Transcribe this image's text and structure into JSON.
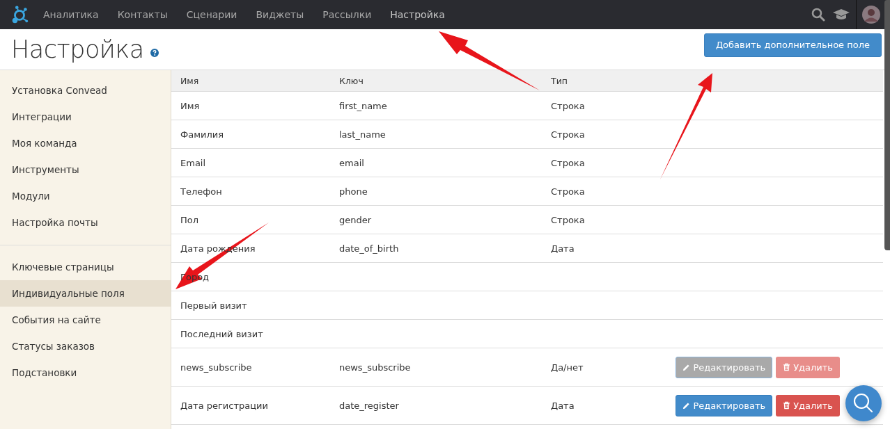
{
  "nav": {
    "items": [
      {
        "label": "Аналитика",
        "selected": false
      },
      {
        "label": "Контакты",
        "selected": false
      },
      {
        "label": "Сценарии",
        "selected": false
      },
      {
        "label": "Виджеты",
        "selected": false
      },
      {
        "label": "Рассылки",
        "selected": false
      },
      {
        "label": "Настройка",
        "selected": true
      }
    ]
  },
  "page": {
    "title": "Настройка",
    "add_button": "Добавить дополнительное поле"
  },
  "sidebar": {
    "groups": [
      [
        {
          "label": "Установка Convead",
          "selected": false
        },
        {
          "label": "Интеграции",
          "selected": false
        },
        {
          "label": "Моя команда",
          "selected": false
        },
        {
          "label": "Инструменты",
          "selected": false
        },
        {
          "label": "Модули",
          "selected": false
        },
        {
          "label": "Настройка почты",
          "selected": false
        }
      ],
      [
        {
          "label": "Ключевые страницы",
          "selected": false
        },
        {
          "label": "Индивидуальные поля",
          "selected": true
        },
        {
          "label": "События на сайте",
          "selected": false
        },
        {
          "label": "Статусы заказов",
          "selected": false
        },
        {
          "label": "Подстановки",
          "selected": false
        }
      ]
    ]
  },
  "table": {
    "columns": [
      "Имя",
      "Ключ",
      "Тип"
    ],
    "rows": [
      {
        "name": "Имя",
        "key": "first_name",
        "type": "Строка"
      },
      {
        "name": "Фамилия",
        "key": "last_name",
        "type": "Строка"
      },
      {
        "name": "Email",
        "key": "email",
        "type": "Строка"
      },
      {
        "name": "Телефон",
        "key": "phone",
        "type": "Строка"
      },
      {
        "name": "Пол",
        "key": "gender",
        "type": "Строка"
      },
      {
        "name": "Дата рождения",
        "key": "date_of_birth",
        "type": "Дата"
      },
      {
        "name": "Город"
      },
      {
        "name": "Первый визит"
      },
      {
        "name": "Последний визит"
      },
      {
        "name": "news_subscribe",
        "key": "news_subscribe",
        "type": "Да/нет",
        "actions": {
          "edit": "Редактировать",
          "delete": "Удалить",
          "disabled": true
        }
      },
      {
        "name": "Дата регистрации",
        "key": "date_register",
        "type": "Дата",
        "actions": {
          "edit": "Редактировать",
          "delete": "Удалить",
          "disabled": false
        }
      }
    ]
  }
}
